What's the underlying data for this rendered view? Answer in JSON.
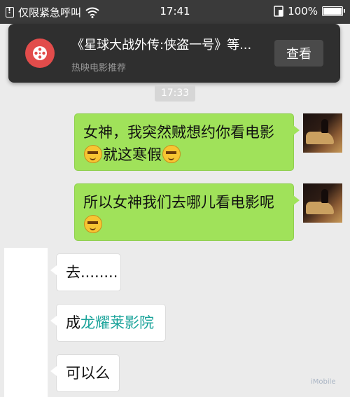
{
  "status_bar": {
    "carrier": "仅限紧急呼叫",
    "time": "17:41",
    "battery": "100%",
    "battery_level": 1.0
  },
  "notification": {
    "title": "《星球大战外传:侠盗一号》等...",
    "subtitle": "热映电影推荐",
    "action": "查看"
  },
  "chat": {
    "timestamp": "17:33",
    "messages": [
      {
        "direction": "out",
        "line1": "女神，我突然贼想约你看电影",
        "line2_text": "就这寒假"
      },
      {
        "direction": "out",
        "line1": "所以女神我们去哪儿看电影呢"
      },
      {
        "direction": "in",
        "text": "去........"
      },
      {
        "direction": "in",
        "prefix": "成",
        "link": "龙耀莱影院"
      },
      {
        "direction": "in",
        "text": "可以么"
      }
    ]
  },
  "watermark": "iMobile"
}
